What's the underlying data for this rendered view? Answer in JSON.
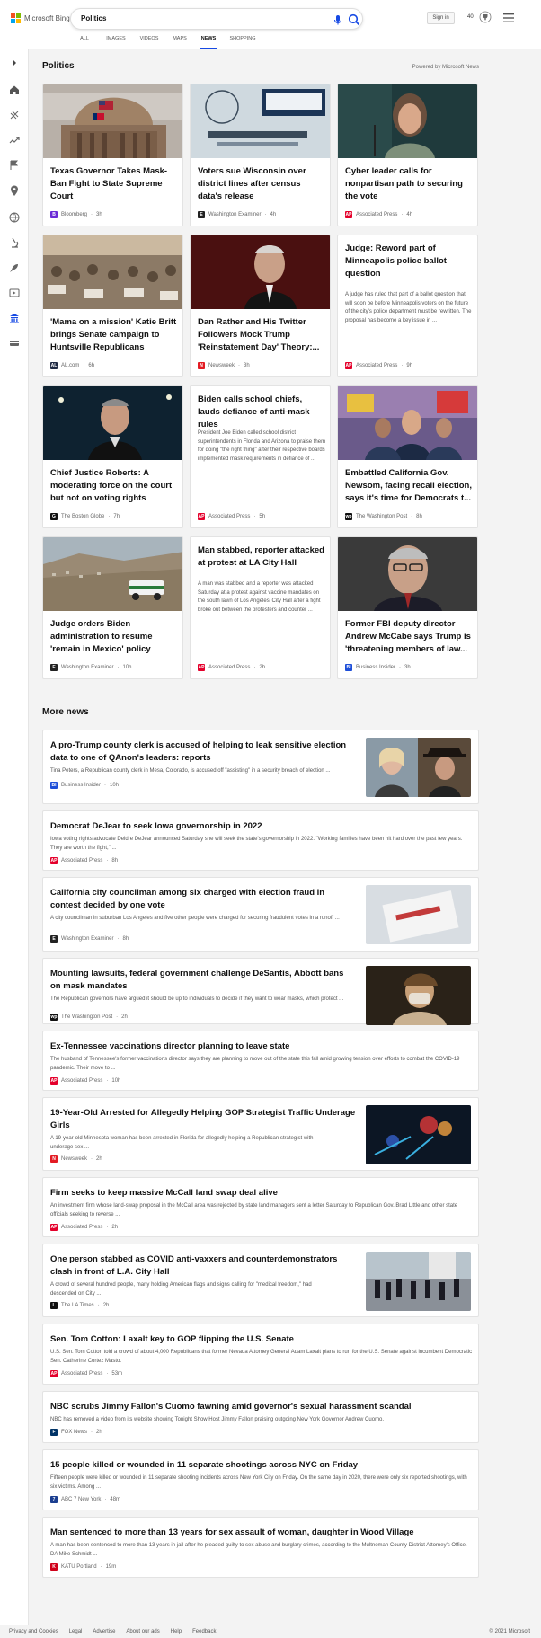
{
  "header": {
    "logo_text": "Microsoft Bing",
    "search_value": "Politics",
    "signin": "Sign in",
    "points": "40"
  },
  "tabs": [
    "ALL",
    "IMAGES",
    "VIDEOS",
    "MAPS",
    "NEWS",
    "SHOPPING"
  ],
  "section": {
    "title": "Politics",
    "powered": "Powered by Microsoft News"
  },
  "cards": [
    {
      "title": "Texas Governor Takes Mask-Ban Fight to State Supreme Court",
      "snippet": "",
      "source": "Bloomberg",
      "time": "3h",
      "icon": "B",
      "icon_color": "#6a2bd6"
    },
    {
      "title": "Voters sue Wisconsin over district lines after census data's release",
      "snippet": "",
      "source": "Washington Examiner",
      "time": "4h",
      "icon": "E",
      "icon_color": "#222"
    },
    {
      "title": "Cyber leader calls for nonpartisan path to securing the vote",
      "snippet": "",
      "source": "Associated Press",
      "time": "4h",
      "icon": "AP",
      "icon_color": "#e4002b"
    },
    {
      "title": "'Mama on a mission' Katie Britt brings Senate campaign to Huntsville Republicans",
      "snippet": "",
      "source": "AL.com",
      "time": "6h",
      "icon": "AL",
      "icon_color": "#1f2a44"
    },
    {
      "title": "Dan Rather and His Twitter Followers Mock Trump 'Reinstatement Day' Theory:...",
      "snippet": "",
      "source": "Newsweek",
      "time": "3h",
      "icon": "N",
      "icon_color": "#e31b23"
    },
    {
      "title": "Judge: Reword part of Minneapolis police ballot question",
      "snippet": "A judge has ruled that part of a ballot question that will soon be before Minneapolis voters on the future of the city's police department must be rewritten. The proposal has become a key issue in ...",
      "source": "Associated Press",
      "time": "9h",
      "icon": "AP",
      "icon_color": "#e4002b"
    },
    {
      "title": "Chief Justice Roberts: A moderating force on the court but not on voting rights",
      "snippet": "",
      "source": "The Boston Globe",
      "time": "7h",
      "icon": "G",
      "icon_color": "#111"
    },
    {
      "title": "Biden calls school chiefs, lauds defiance of anti-mask rules",
      "snippet": "President Joe Biden called school district superintendents in Florida and Arizona to praise them for doing \"the right thing\" after their respective boards implemented mask requirements in defiance of ...",
      "source": "Associated Press",
      "time": "5h",
      "icon": "AP",
      "icon_color": "#e4002b"
    },
    {
      "title": "Embattled California Gov. Newsom, facing recall election, says it's time for Democrats t...",
      "snippet": "",
      "source": "The Washington Post",
      "time": "8h",
      "icon": "wp",
      "icon_color": "#111"
    },
    {
      "title": "Judge orders Biden administration to resume 'remain in Mexico' policy",
      "snippet": "",
      "source": "Washington Examiner",
      "time": "10h",
      "icon": "E",
      "icon_color": "#222"
    },
    {
      "title": "Man stabbed, reporter attacked at protest at LA City Hall",
      "snippet": "A man was stabbed and a reporter was attacked Saturday at a protest against vaccine mandates on the south lawn of Los Angeles' City Hall after a fight broke out between the protesters and counter ...",
      "source": "Associated Press",
      "time": "2h",
      "icon": "AP",
      "icon_color": "#e4002b"
    },
    {
      "title": "Former FBI deputy director Andrew McCabe says Trump is 'threatening members of law...",
      "snippet": "",
      "source": "Business Insider",
      "time": "3h",
      "icon": "BI",
      "icon_color": "#1d4ed8"
    }
  ],
  "more": {
    "title": "More news",
    "items": [
      {
        "title": "A pro-Trump county clerk is accused of helping to leak sensitive election data to one of QAnon's leaders: reports",
        "snippet": "Tina Peters, a Republican county clerk in Mesa, Colorado, is accused off \"assisting\" in a security breach of election ...",
        "source": "Business Insider",
        "time": "10h",
        "icon": "BI",
        "icon_color": "#1d4ed8"
      },
      {
        "title": "Democrat DeJear to seek Iowa governorship in 2022",
        "snippet": "Iowa voting rights advocate Deidre DeJear announced Saturday she will seek the state's governorship in 2022. \"Working families have been hit hard over the past few years. They are worth the fight,\" ...",
        "source": "Associated Press",
        "time": "8h",
        "icon": "AP",
        "icon_color": "#e4002b"
      },
      {
        "title": "California city councilman among six charged with election fraud in contest decided by one vote",
        "snippet": "A city councilman in suburban Los Angeles and five other people were charged for securing fraudulent votes in a runoff ...",
        "source": "Washington Examiner",
        "time": "8h",
        "icon": "E",
        "icon_color": "#222"
      },
      {
        "title": "Mounting lawsuits, federal government challenge DeSantis, Abbott bans on mask mandates",
        "snippet": "The Republican governors have argued it should be up to individuals to decide if they want to wear masks, which protect ...",
        "source": "The Washington Post",
        "time": "2h",
        "icon": "wp",
        "icon_color": "#111"
      },
      {
        "title": "Ex-Tennessee vaccinations director planning to leave state",
        "snippet": "The husband of Tennessee's former vaccinations director says they are planning to move out of the state this fall amid growing tension over efforts to combat the COVID-19 pandemic. Their move to ...",
        "source": "Associated Press",
        "time": "10h",
        "icon": "AP",
        "icon_color": "#e4002b"
      },
      {
        "title": "19-Year-Old Arrested for Allegedly Helping GOP Strategist Traffic Underage Girls",
        "snippet": "A 19-year-old Minnesota woman has been arrested in Florida for allegedly helping a Republican strategist with underage sex ...",
        "source": "Newsweek",
        "time": "2h",
        "icon": "N",
        "icon_color": "#e31b23"
      },
      {
        "title": "Firm seeks to keep massive McCall land swap deal alive",
        "snippet": "An investment firm whose land-swap proposal in the McCall area was rejected by state land managers sent a letter Saturday to Republican Gov. Brad Little and other state officials seeking to reverse ...",
        "source": "Associated Press",
        "time": "2h",
        "icon": "AP",
        "icon_color": "#e4002b"
      },
      {
        "title": "One person stabbed as COVID anti-vaxxers and counterdemonstrators clash in front of L.A. City Hall",
        "snippet": "A crowd of several hundred people, many holding American flags and signs calling for \"medical freedom,\" had descended on City ...",
        "source": "The LA Times",
        "time": "2h",
        "icon": "L",
        "icon_color": "#111"
      },
      {
        "title": "Sen. Tom Cotton: Laxalt key to GOP flipping the U.S. Senate",
        "snippet": "U.S. Sen. Tom Cotton told a crowd of about 4,000 Republicans that former Nevada Attorney General Adam Laxalt plans to run for the U.S. Senate against incumbent Democratic Sen. Catherine Cortez Masto.",
        "source": "Associated Press",
        "time": "53m",
        "icon": "AP",
        "icon_color": "#e4002b"
      },
      {
        "title": "NBC scrubs Jimmy Fallon's Cuomo fawning amid governor's sexual harassment scandal",
        "snippet": "NBC has removed a video from its website showing Tonight Show Host Jimmy Fallon praising outgoing New York Governor Andrew Cuomo.",
        "source": "FOX News",
        "time": "2h",
        "icon": "F",
        "icon_color": "#003366"
      },
      {
        "title": "15 people killed or wounded in 11 separate shootings across NYC on Friday",
        "snippet": "Fifteen people were killed or wounded in 11 separate shooting incidents across New York City on Friday. On the same day in 2020, there were only six reported shootings, with six victims. Among ...",
        "source": "ABC 7 New York",
        "time": "48m",
        "icon": "7",
        "icon_color": "#1a3d8f"
      },
      {
        "title": "Man sentenced to more than 13 years for sex assault of woman, daughter in Wood Village",
        "snippet": "A man has been sentenced to more than 13 years in jail after he pleaded guilty to sex abuse and burglary crimes, according to the Multnomah County District Attorney's Office. DA Mike Schmidt ...",
        "source": "KATU Portland",
        "time": "19m",
        "icon": "K",
        "icon_color": "#d0021b"
      }
    ]
  },
  "footer": {
    "links": [
      "Privacy and Cookies",
      "Legal",
      "Advertise",
      "About our ads",
      "Help",
      "Feedback"
    ],
    "copyright": "© 2021 Microsoft"
  }
}
